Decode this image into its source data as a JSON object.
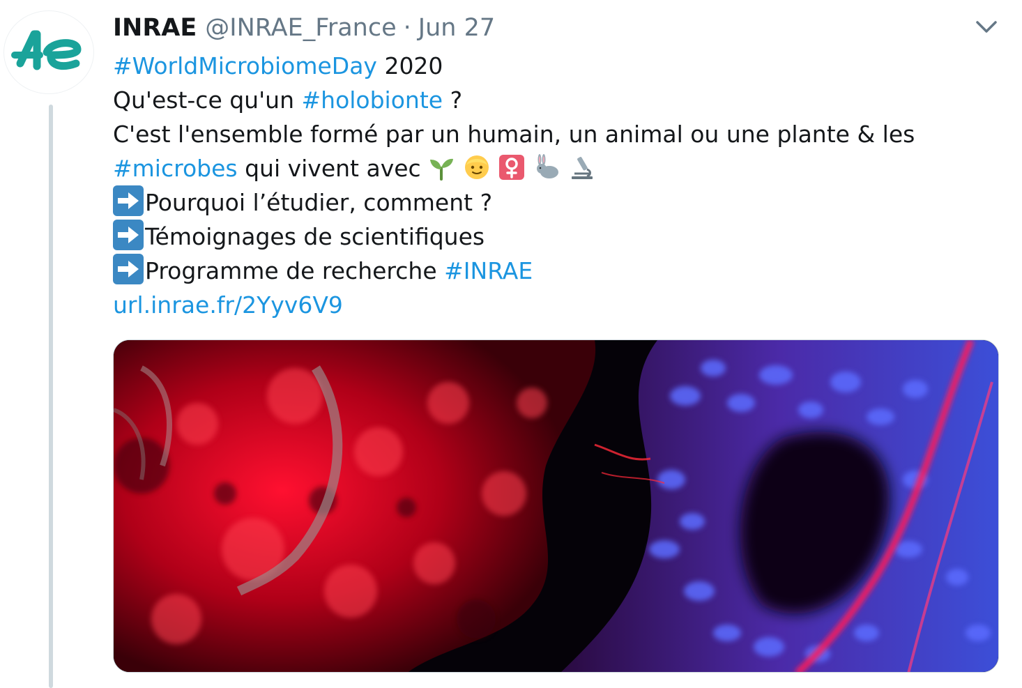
{
  "account": {
    "name": "INRAE",
    "handle": "@INRAE_France",
    "separator": "·",
    "date": "Jun 27",
    "avatar_icon": "inrae-logo-icon",
    "avatar_color": "#1aa39a"
  },
  "tweet": {
    "line1": {
      "tag": "#WorldMicrobiomeDay",
      "text": " 2020"
    },
    "line2": {
      "text_before": "Qu'est-ce qu'un ",
      "tag": "#holobionte",
      "text_after": " ?"
    },
    "line3": {
      "text": "C'est l'ensemble formé par un humain, un animal ou une plante & les"
    },
    "line4": {
      "tag": "#microbes",
      "text": " qui vivent avec",
      "emojis": [
        "seedling-icon",
        "person-icon",
        "female-sign-icon",
        "rabbit-icon",
        "microscope-icon"
      ]
    },
    "bullets": [
      {
        "icon": "right-arrow-icon",
        "text": "Pourquoi l’étudier, comment ?"
      },
      {
        "icon": "right-arrow-icon",
        "text": "Témoignages de scientifiques"
      },
      {
        "icon": "right-arrow-icon",
        "text_before": "Programme de recherche ",
        "tag": "#INRAE"
      }
    ],
    "url": "url.inrae.fr/2Yyv6V9"
  },
  "colors": {
    "link": "#1b95e0",
    "text": "#14171a",
    "muted": "#657786",
    "arrow_box": "#3b88c3"
  }
}
